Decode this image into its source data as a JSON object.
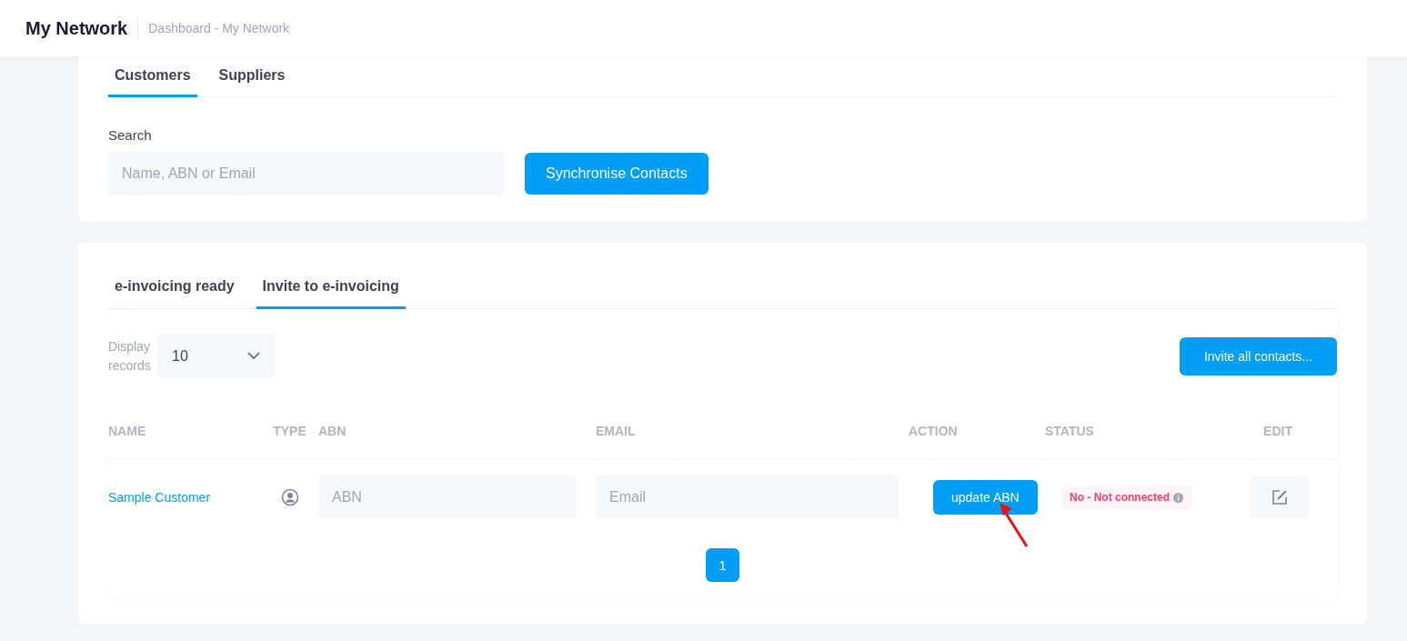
{
  "header": {
    "title": "My Network",
    "breadcrumb": "Dashboard - My Network"
  },
  "contact_tabs": [
    {
      "label": "Customers",
      "selected": true
    },
    {
      "label": "Suppliers",
      "selected": false
    }
  ],
  "search": {
    "label": "Search",
    "placeholder": "Name, ABN or Email"
  },
  "sync_button": "Synchronise Contacts",
  "invoice_tabs": [
    {
      "label": "e-invoicing ready",
      "selected": false
    },
    {
      "label": "Invite to e-invoicing",
      "selected": true
    }
  ],
  "display_records": {
    "label": "Display records",
    "value": "10"
  },
  "invite_button": "Invite all contacts...",
  "table": {
    "columns": [
      "NAME",
      "TYPE",
      "ABN",
      "EMAIL",
      "ACTION",
      "STATUS",
      "EDIT"
    ],
    "rows": [
      {
        "name": "Sample Customer",
        "abn_placeholder": "ABN",
        "email_placeholder": "Email",
        "action": "update ABN",
        "status": "No - Not connected"
      }
    ]
  },
  "pagination": [
    {
      "label": "1",
      "selected": true
    }
  ]
}
